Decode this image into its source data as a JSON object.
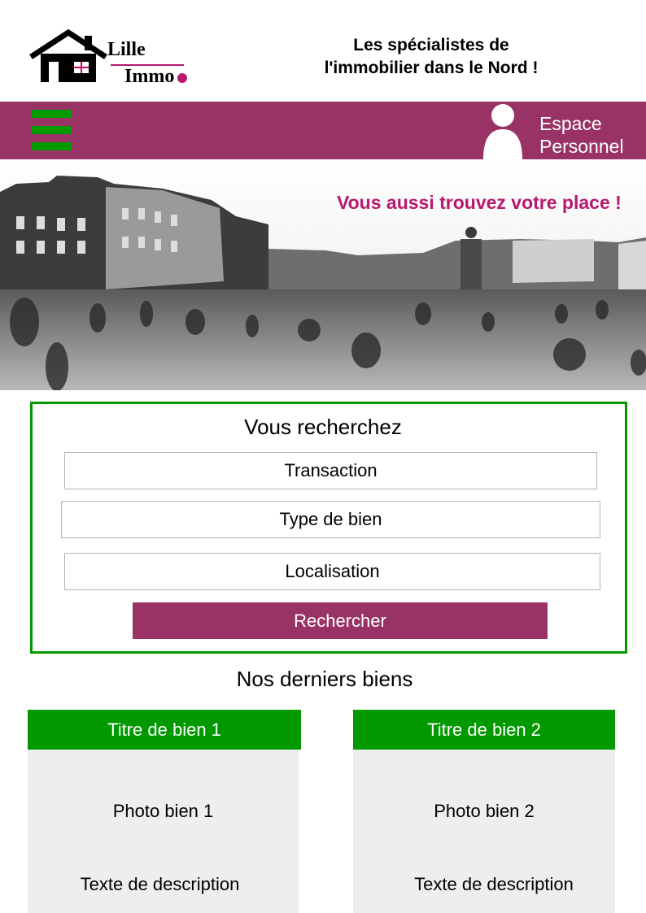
{
  "header": {
    "logo": {
      "text_top": "Lille",
      "text_bottom": "Immo"
    },
    "tagline_line1": "Les spécialistes de",
    "tagline_line2": "l'immobilier dans le Nord !"
  },
  "nav": {
    "menu_icon": "hamburger-icon",
    "account_icon": "user-icon",
    "account_line1": "Espace",
    "account_line2": "Personnel"
  },
  "banner": {
    "slogan": "Vous aussi trouvez votre place !"
  },
  "search": {
    "title": "Vous recherchez",
    "transaction": "Transaction",
    "property_type": "Type de bien",
    "location": "Localisation",
    "submit": "Rechercher"
  },
  "listings": {
    "title": "Nos derniers biens",
    "items": [
      {
        "title": "Titre de bien 1",
        "photo": "Photo bien 1",
        "description": "Texte de description"
      },
      {
        "title": "Titre de bien 2",
        "photo": "Photo bien 2",
        "description": "Texte de description"
      }
    ]
  },
  "colors": {
    "brand": "#993366",
    "accent": "#009900",
    "slogan": "#b8186f",
    "card_bg": "#eeeeee"
  }
}
